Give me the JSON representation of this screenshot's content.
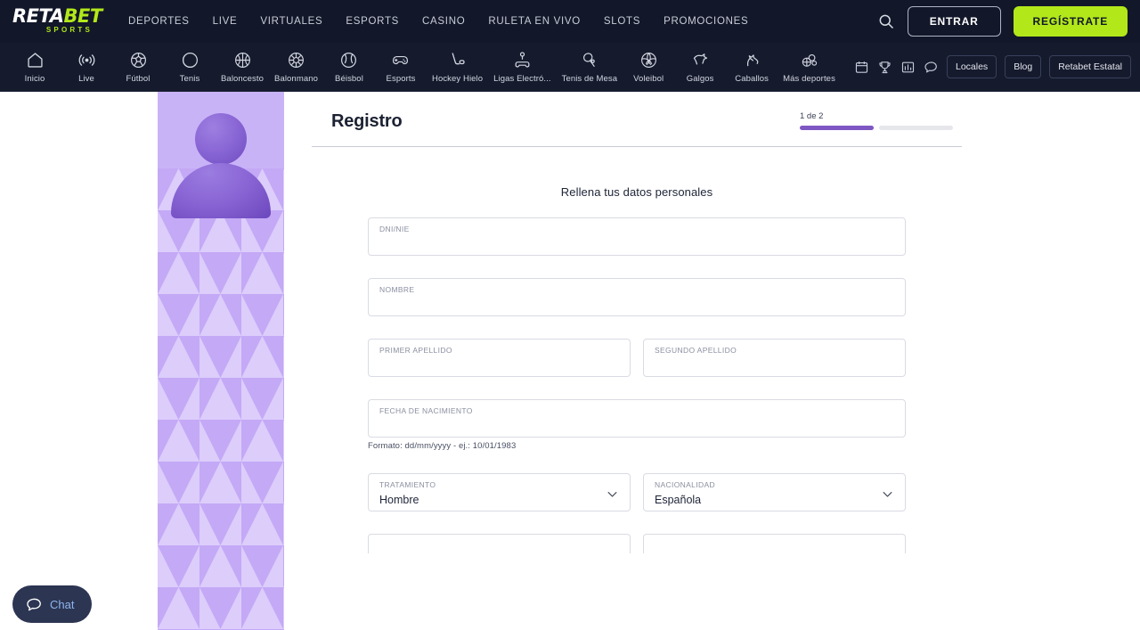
{
  "brand": {
    "logo_main_part1": "RETA",
    "logo_main_part2": "BET",
    "logo_sub": "SPORTS",
    "accent_green": "#b2e81a",
    "nav_bg": "#121729",
    "progress_purple": "#7e57c2",
    "panel_lavender": "#c9b3f7"
  },
  "topnav": {
    "links": [
      {
        "label": "DEPORTES",
        "name": "nav-deportes"
      },
      {
        "label": "LIVE",
        "name": "nav-live"
      },
      {
        "label": "VIRTUALES",
        "name": "nav-virtuales"
      },
      {
        "label": "ESPORTS",
        "name": "nav-esports"
      },
      {
        "label": "CASINO",
        "name": "nav-casino"
      },
      {
        "label": "RULETA EN VIVO",
        "name": "nav-ruleta-en-vivo"
      },
      {
        "label": "SLOTS",
        "name": "nav-slots"
      },
      {
        "label": "PROMOCIONES",
        "name": "nav-promociones"
      }
    ],
    "login_button": "ENTRAR",
    "register_button": "REGÍSTRATE",
    "search_icon": "search-icon"
  },
  "sportsbar": {
    "items": [
      {
        "label": "Inicio",
        "icon": "home-icon"
      },
      {
        "label": "Live",
        "icon": "live-signal-icon"
      },
      {
        "label": "Fútbol",
        "icon": "soccer-ball-icon"
      },
      {
        "label": "Tenis",
        "icon": "tennis-ball-icon"
      },
      {
        "label": "Baloncesto",
        "icon": "basketball-icon"
      },
      {
        "label": "Balonmano",
        "icon": "handball-icon"
      },
      {
        "label": "Béisbol",
        "icon": "baseball-icon"
      },
      {
        "label": "Esports",
        "icon": "gamepad-icon"
      },
      {
        "label": "Hockey Hielo",
        "icon": "ice-hockey-icon"
      },
      {
        "label": "Ligas Electró...",
        "icon": "e-league-icon"
      },
      {
        "label": "Tenis de Mesa",
        "icon": "table-tennis-icon"
      },
      {
        "label": "Voleibol",
        "icon": "volleyball-icon"
      },
      {
        "label": "Galgos",
        "icon": "greyhound-icon"
      },
      {
        "label": "Caballos",
        "icon": "horse-icon"
      },
      {
        "label": "Más deportes",
        "icon": "more-sports-icon"
      }
    ],
    "right_icons": [
      {
        "icon": "calendar-icon"
      },
      {
        "icon": "trophy-icon"
      },
      {
        "icon": "stats-bar-icon"
      },
      {
        "icon": "chat-bubble-icon"
      }
    ],
    "right_pills": [
      {
        "label": "Locales",
        "name": "pill-locales"
      },
      {
        "label": "Blog",
        "name": "pill-blog"
      },
      {
        "label": "Retabet Estatal",
        "name": "pill-retabet-estatal"
      }
    ]
  },
  "registration": {
    "title": "Registro",
    "progress_label": "1 de 2",
    "progress_current": 1,
    "progress_total": 2,
    "subtitle": "Rellena tus datos personales",
    "fields": {
      "dni": {
        "label": "DNI/NIE",
        "value": ""
      },
      "nombre": {
        "label": "NOMBRE",
        "value": ""
      },
      "primer_apellido": {
        "label": "PRIMER APELLIDO",
        "value": ""
      },
      "segundo_apellido": {
        "label": "SEGUNDO APELLIDO",
        "value": ""
      },
      "fecha_nacimiento": {
        "label": "FECHA DE NACIMIENTO",
        "value": "",
        "hint": "Formato: dd/mm/yyyy - ej.: 10/01/1983"
      },
      "tratamiento": {
        "label": "TRATAMIENTO",
        "value": "Hombre"
      },
      "nacionalidad": {
        "label": "NACIONALIDAD",
        "value": "Española"
      }
    }
  },
  "chat_widget": {
    "label": "Chat",
    "icon": "chat-bubble-icon"
  }
}
